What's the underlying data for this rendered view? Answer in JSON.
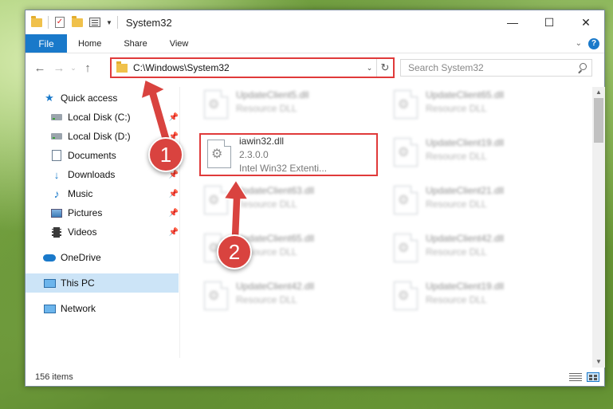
{
  "window": {
    "title": "System32",
    "controls": {
      "minimize": "—",
      "maximize": "☐",
      "close": "✕"
    }
  },
  "ribbon": {
    "tabs": [
      "File",
      "Home",
      "Share",
      "View"
    ],
    "help": "?"
  },
  "navbar": {
    "address": "C:\\Windows\\System32",
    "search_placeholder": "Search System32"
  },
  "sidebar": {
    "quick_access": "Quick access",
    "items": [
      {
        "label": "Local Disk (C:)",
        "icon": "drive-icon",
        "pinned": true
      },
      {
        "label": "Local Disk (D:)",
        "icon": "drive-icon",
        "pinned": true
      },
      {
        "label": "Documents",
        "icon": "documents-icon",
        "pinned": true
      },
      {
        "label": "Downloads",
        "icon": "downloads-icon",
        "pinned": true
      },
      {
        "label": "Music",
        "icon": "music-icon",
        "pinned": true
      },
      {
        "label": "Pictures",
        "icon": "pictures-icon",
        "pinned": true
      },
      {
        "label": "Videos",
        "icon": "videos-icon",
        "pinned": true
      }
    ],
    "onedrive": "OneDrive",
    "this_pc": "This PC",
    "network": "Network"
  },
  "files": {
    "left": [
      {
        "name": "UpdateClient5.dll",
        "desc": "Resource DLL"
      },
      {
        "name": "iawin32.dll",
        "version": "2.3.0.0",
        "desc": "Intel Win32 Extenti..."
      },
      {
        "name": "UpdateClient63.dll",
        "desc": "Resource DLL"
      },
      {
        "name": "UpdateClient65.dll",
        "desc": "Resource DLL"
      },
      {
        "name": "UpdateClient42.dll",
        "desc": "Resource DLL"
      }
    ],
    "right": [
      {
        "name": "UpdateClient65.dll",
        "desc": "Resource DLL"
      },
      {
        "name": "UpdateClient19.dll",
        "desc": "Resource DLL"
      },
      {
        "name": "UpdateClient21.dll",
        "desc": "Resource DLL"
      },
      {
        "name": "UpdateClient42.dll",
        "desc": "Resource DLL"
      },
      {
        "name": "UpdateClient19.dll",
        "desc": "Resource DLL"
      }
    ]
  },
  "status": {
    "item_count": "156 items"
  },
  "annotations": {
    "step1": "1",
    "step2": "2",
    "color": "#d9433f"
  }
}
